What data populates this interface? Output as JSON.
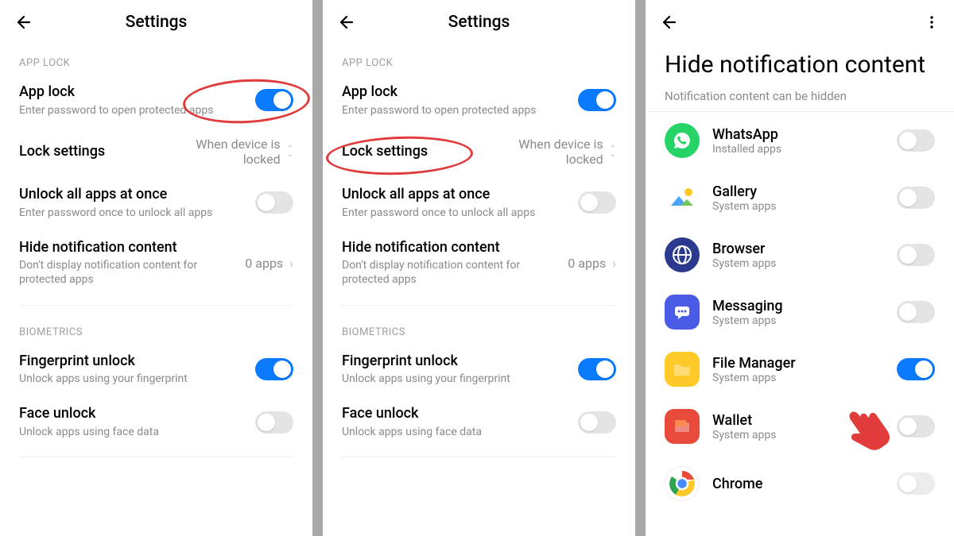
{
  "screens": [
    {
      "title": "Settings",
      "sections": [
        {
          "header": "APP LOCK",
          "items": [
            {
              "title": "App lock",
              "sub": "Enter password to open protected apps",
              "type": "toggle",
              "on": true
            },
            {
              "title": "Lock settings",
              "value": "When device is locked",
              "type": "select"
            },
            {
              "title": "Unlock all apps at once",
              "sub": "Enter password once to unlock all apps",
              "type": "toggle",
              "on": false
            },
            {
              "title": "Hide notification content",
              "sub": "Don't display notification content for protected apps",
              "value": "0 apps",
              "type": "link"
            }
          ]
        },
        {
          "header": "BIOMETRICS",
          "items": [
            {
              "title": "Fingerprint unlock",
              "sub": "Unlock apps using your fingerprint",
              "type": "toggle",
              "on": true
            },
            {
              "title": "Face unlock",
              "sub": "Unlock apps using face data",
              "type": "toggle",
              "on": false
            }
          ]
        }
      ]
    },
    {
      "title": "Settings",
      "sections": [
        {
          "header": "APP LOCK",
          "items": [
            {
              "title": "App lock",
              "sub": "Enter password to open protected apps",
              "type": "toggle",
              "on": true
            },
            {
              "title": "Lock settings",
              "value": "When device is locked",
              "type": "select"
            },
            {
              "title": "Unlock all apps at once",
              "sub": "Enter password once to unlock all apps",
              "type": "toggle",
              "on": false
            },
            {
              "title": "Hide notification content",
              "sub": "Don't display notification content for protected apps",
              "value": "0 apps",
              "type": "link"
            }
          ]
        },
        {
          "header": "BIOMETRICS",
          "items": [
            {
              "title": "Fingerprint unlock",
              "sub": "Unlock apps using your fingerprint",
              "type": "toggle",
              "on": true
            },
            {
              "title": "Face unlock",
              "sub": "Unlock apps using face data",
              "type": "toggle",
              "on": false
            }
          ]
        }
      ]
    },
    {
      "big_title": "Hide notification content",
      "subtitle": "Notification content can be hidden",
      "apps": [
        {
          "name": "WhatsApp",
          "sub": "Installed apps",
          "icon": "whatsapp",
          "on": false
        },
        {
          "name": "Gallery",
          "sub": "System apps",
          "icon": "gallery",
          "on": false
        },
        {
          "name": "Browser",
          "sub": "System apps",
          "icon": "browser",
          "on": false
        },
        {
          "name": "Messaging",
          "sub": "System apps",
          "icon": "messaging",
          "on": false
        },
        {
          "name": "File Manager",
          "sub": "System apps",
          "icon": "file",
          "on": true
        },
        {
          "name": "Wallet",
          "sub": "System apps",
          "icon": "wallet",
          "on": false
        },
        {
          "name": "Chrome",
          "sub": "",
          "icon": "chrome",
          "on": false
        }
      ]
    }
  ]
}
